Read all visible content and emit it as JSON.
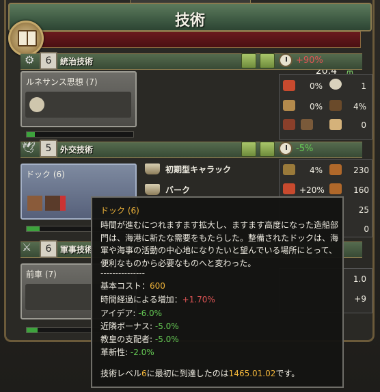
{
  "window": {
    "title": "技術",
    "points": "20.4"
  },
  "sections": [
    {
      "level": "6",
      "name": "統治技術",
      "modifier": "+90%",
      "idea": {
        "title": "ルネサンス思想 (7)",
        "progress": 0.08
      }
    },
    {
      "level": "5",
      "name": "外交技術",
      "modifier": "-5%",
      "idea": {
        "title": "ドック (6)",
        "progress": 0.12
      }
    },
    {
      "level": "6",
      "name": "軍事技術",
      "modifier": "",
      "idea": {
        "title": "前車 (7)",
        "progress": 0.1
      }
    }
  ],
  "admin_stats": [
    {
      "icon": "stability-icon",
      "value": "0%"
    },
    {
      "icon": "advisor-icon",
      "value": "1"
    },
    {
      "icon": "map-icon",
      "value": "0%"
    },
    {
      "icon": "production-icon",
      "value": "4%"
    },
    {
      "icon": "fleet-icon",
      "value": "0%"
    },
    {
      "icon": "goods-icon",
      "value": "0"
    }
  ],
  "diplo_stats": [
    {
      "icon": "cannon-icon",
      "value": "4%"
    },
    {
      "icon": "ship-count-icon",
      "value": "230"
    },
    {
      "icon": "hammer-icon",
      "value": "+20%"
    },
    {
      "icon": "sail-icon",
      "value": "160"
    },
    {
      "icon": "crew-icon",
      "value": "25"
    },
    {
      "icon": "dock-icon",
      "value": "0"
    }
  ],
  "mil_stats": [
    {
      "value": "1.0"
    },
    {
      "value": "+9"
    }
  ],
  "ships": [
    {
      "name": "初期型キャラック"
    },
    {
      "name": "バーク"
    }
  ],
  "tooltip": {
    "title": "ドック (6)",
    "description": "時間が進むにつれますます拡大し、ますます高度になった造船部門は、海港に新たな需要をもたらした。整備されたドックは、海軍や海事の活動の中心地になりたいと望んでいる場所にとって、便利なものから必要なものへと変わった。",
    "divider": "---------------",
    "base_cost_label": "基本コスト：",
    "base_cost": "600",
    "time_label": "時間経過による増加：",
    "time_value": "+1.70%",
    "idea_label": "アイデア: ",
    "idea_value": "-6.0%",
    "neighbor_label": "近隣ボーナス: ",
    "neighbor_value": "-5.0%",
    "papal_label": "教皇の支配者: ",
    "papal_value": "-5.0%",
    "innov_label": "革新性: ",
    "innov_value": "-2.0%",
    "first_a": "技術レベル",
    "first_level": "6",
    "first_b": "に最初に到達したのは",
    "first_date": "1465.01.02",
    "first_c": "です。"
  },
  "colors": {
    "positive": "#66cc55",
    "negative": "#e05555",
    "highlight": "#f0b43a"
  }
}
